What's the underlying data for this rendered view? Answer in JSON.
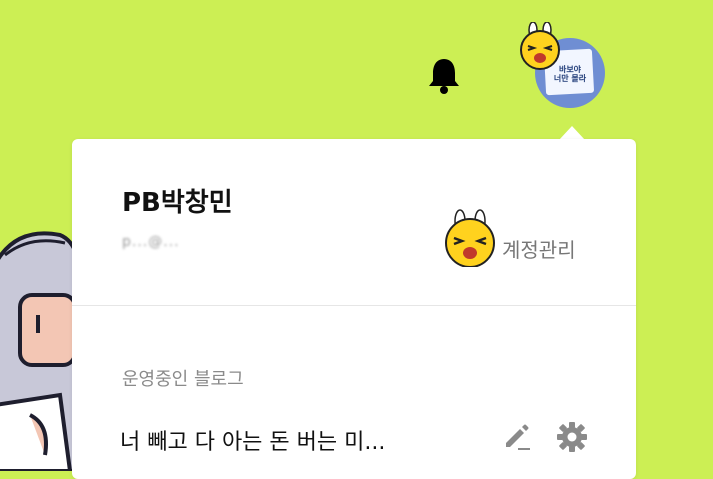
{
  "header": {
    "notification_icon": "bell-icon",
    "profile_image_text": "바보야\n너만 몰라"
  },
  "profile": {
    "name": "PB박창민",
    "email": "p...@...",
    "account_manage_label": "계정관리"
  },
  "blogs": {
    "section_title": "운영중인 블로그",
    "items": [
      {
        "title": "너 빼고 다 아는 돈 버는 미..."
      }
    ]
  },
  "colors": {
    "background": "#ccef54",
    "icon": "#333333",
    "muted_text": "#8a8a8a"
  }
}
